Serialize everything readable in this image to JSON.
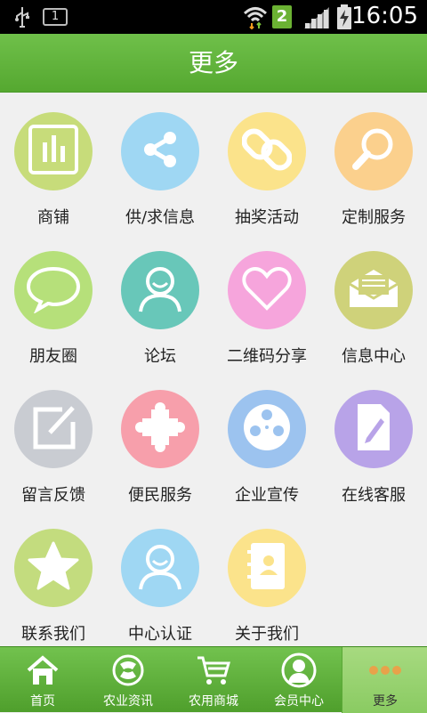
{
  "status_bar": {
    "sim_label": "1",
    "network_badge": "2",
    "time": "16:05"
  },
  "header": {
    "title": "更多"
  },
  "grid": {
    "items": [
      {
        "label": "商铺",
        "icon": "bar-chart-icon",
        "color": "#c7dc7a"
      },
      {
        "label": "供/求信息",
        "icon": "share-icon",
        "color": "#9fd7f3"
      },
      {
        "label": "抽奖活动",
        "icon": "link-chain-icon",
        "color": "#fbe38b"
      },
      {
        "label": "定制服务",
        "icon": "magnifier-icon",
        "color": "#fbd08d"
      },
      {
        "label": "朋友圈",
        "icon": "chat-bubble-icon",
        "color": "#b6e07a"
      },
      {
        "label": "论坛",
        "icon": "user-icon",
        "color": "#68c7b9"
      },
      {
        "label": "二维码分享",
        "icon": "heart-icon",
        "color": "#f6a5dc"
      },
      {
        "label": "信息中心",
        "icon": "envelope-icon",
        "color": "#cfd27a"
      },
      {
        "label": "留言反馈",
        "icon": "edit-note-icon",
        "color": "#c9ccd2"
      },
      {
        "label": "便民服务",
        "icon": "puzzle-icon",
        "color": "#f79fab"
      },
      {
        "label": "企业宣传",
        "icon": "film-reel-icon",
        "color": "#9cc3ef"
      },
      {
        "label": "在线客服",
        "icon": "document-edit-icon",
        "color": "#b8a3e8"
      },
      {
        "label": "联系我们",
        "icon": "star-icon",
        "color": "#c3dc7e"
      },
      {
        "label": "中心认证",
        "icon": "user-icon",
        "color": "#9fd7f3"
      },
      {
        "label": "关于我们",
        "icon": "address-book-icon",
        "color": "#fbe38b"
      }
    ]
  },
  "tabbar": {
    "tabs": [
      {
        "label": "首页",
        "icon": "home-icon"
      },
      {
        "label": "农业资讯",
        "icon": "news-icon"
      },
      {
        "label": "农用商城",
        "icon": "cart-icon"
      },
      {
        "label": "会员中心",
        "icon": "member-icon"
      },
      {
        "label": "更多",
        "icon": "more-dots-icon",
        "active": true
      }
    ]
  }
}
